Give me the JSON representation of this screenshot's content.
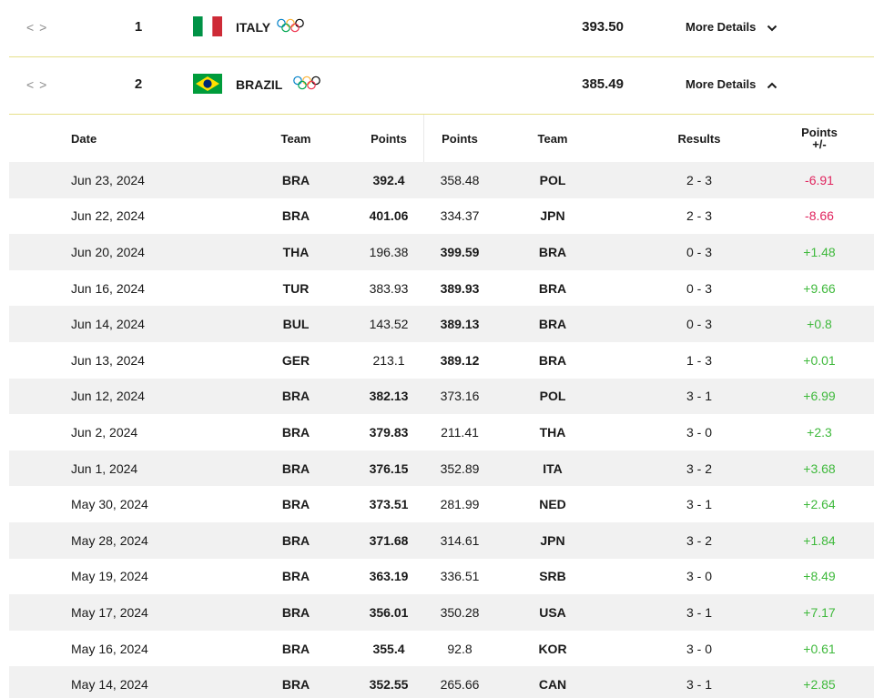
{
  "ranking": [
    {
      "rank": "1",
      "country": "ITALY",
      "points": "393.50",
      "details_label": "More Details",
      "expanded": false,
      "flag_colors": [
        "#009246",
        "#ffffff",
        "#ce2b37"
      ]
    },
    {
      "rank": "2",
      "country": "BRAZIL",
      "points": "385.49",
      "details_label": "More Details",
      "expanded": true,
      "flag_colors": [
        "#009c3b",
        "#ffdf00",
        "#002776"
      ]
    }
  ],
  "table": {
    "headers": {
      "date": "Date",
      "team1": "Team",
      "points1": "Points",
      "points2": "Points",
      "team2": "Team",
      "results": "Results",
      "pm_top": "Points",
      "pm_bottom": "+/-"
    },
    "rows": [
      {
        "date": "Jun 23, 2024",
        "team1": "BRA",
        "points1": "392.4",
        "points2": "358.48",
        "team2": "POL",
        "result": "2 - 3",
        "change": "-6.91",
        "winner": 1
      },
      {
        "date": "Jun 22, 2024",
        "team1": "BRA",
        "points1": "401.06",
        "points2": "334.37",
        "team2": "JPN",
        "result": "2 - 3",
        "change": "-8.66",
        "winner": 1
      },
      {
        "date": "Jun 20, 2024",
        "team1": "THA",
        "points1": "196.38",
        "points2": "399.59",
        "team2": "BRA",
        "result": "0 - 3",
        "change": "+1.48",
        "winner": 2
      },
      {
        "date": "Jun 16, 2024",
        "team1": "TUR",
        "points1": "383.93",
        "points2": "389.93",
        "team2": "BRA",
        "result": "0 - 3",
        "change": "+9.66",
        "winner": 2
      },
      {
        "date": "Jun 14, 2024",
        "team1": "BUL",
        "points1": "143.52",
        "points2": "389.13",
        "team2": "BRA",
        "result": "0 - 3",
        "change": "+0.8",
        "winner": 2
      },
      {
        "date": "Jun 13, 2024",
        "team1": "GER",
        "points1": "213.1",
        "points2": "389.12",
        "team2": "BRA",
        "result": "1 - 3",
        "change": "+0.01",
        "winner": 2
      },
      {
        "date": "Jun 12, 2024",
        "team1": "BRA",
        "points1": "382.13",
        "points2": "373.16",
        "team2": "POL",
        "result": "3 - 1",
        "change": "+6.99",
        "winner": 1
      },
      {
        "date": "Jun 2, 2024",
        "team1": "BRA",
        "points1": "379.83",
        "points2": "211.41",
        "team2": "THA",
        "result": "3 - 0",
        "change": "+2.3",
        "winner": 1
      },
      {
        "date": "Jun 1, 2024",
        "team1": "BRA",
        "points1": "376.15",
        "points2": "352.89",
        "team2": "ITA",
        "result": "3 - 2",
        "change": "+3.68",
        "winner": 1
      },
      {
        "date": "May 30, 2024",
        "team1": "BRA",
        "points1": "373.51",
        "points2": "281.99",
        "team2": "NED",
        "result": "3 - 1",
        "change": "+2.64",
        "winner": 1
      },
      {
        "date": "May 28, 2024",
        "team1": "BRA",
        "points1": "371.68",
        "points2": "314.61",
        "team2": "JPN",
        "result": "3 - 2",
        "change": "+1.84",
        "winner": 1
      },
      {
        "date": "May 19, 2024",
        "team1": "BRA",
        "points1": "363.19",
        "points2": "336.51",
        "team2": "SRB",
        "result": "3 - 0",
        "change": "+8.49",
        "winner": 1
      },
      {
        "date": "May 17, 2024",
        "team1": "BRA",
        "points1": "356.01",
        "points2": "350.28",
        "team2": "USA",
        "result": "3 - 1",
        "change": "+7.17",
        "winner": 1
      },
      {
        "date": "May 16, 2024",
        "team1": "BRA",
        "points1": "355.4",
        "points2": "92.8",
        "team2": "KOR",
        "result": "3 - 0",
        "change": "+0.61",
        "winner": 1
      },
      {
        "date": "May 14, 2024",
        "team1": "BRA",
        "points1": "352.55",
        "points2": "265.66",
        "team2": "CAN",
        "result": "3 - 1",
        "change": "+2.85",
        "winner": 1
      }
    ]
  },
  "colors": {
    "positive": "#3fb93c",
    "negative": "#e0245e",
    "divider": "#e6e08a",
    "row_shade": "#f1f1f1",
    "olympic_rings": [
      "#0081c8",
      "#fcb131",
      "#000000",
      "#00a651",
      "#ee334e"
    ]
  },
  "icons": {
    "expand": "code-arrows-icon",
    "olympic": "olympic-rings-icon",
    "chevron_down": "chevron-down-icon",
    "chevron_up": "chevron-up-icon"
  }
}
